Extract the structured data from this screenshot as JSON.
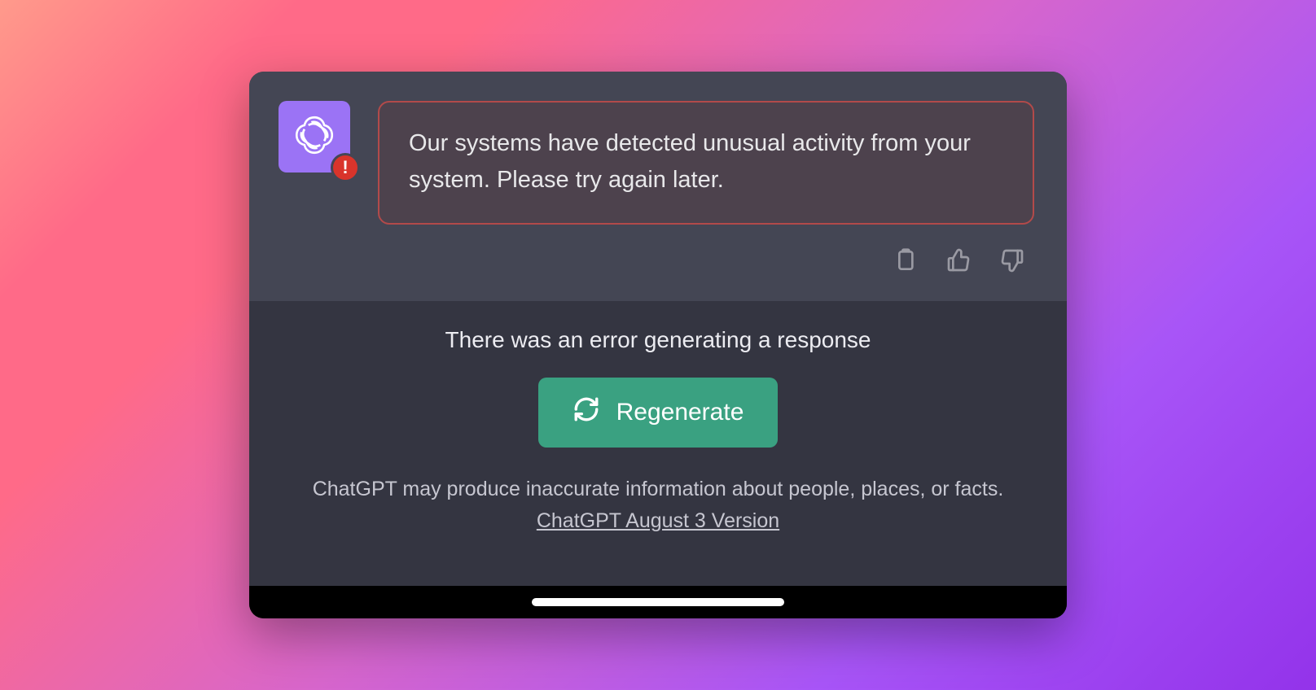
{
  "message": {
    "error_text": "Our systems have detected unusual activity from your system. Please try again later.",
    "avatar_icon": "openai-logo",
    "error_badge_icon": "exclamation"
  },
  "feedback_icons": [
    "copy",
    "thumbs-up",
    "thumbs-down"
  ],
  "footer": {
    "status_text": "There was an error generating a response",
    "regenerate_label": "Regenerate",
    "disclaimer_text": "ChatGPT may produce inaccurate information about people, places, or facts.",
    "version_link_text": "ChatGPT August 3 Version"
  },
  "colors": {
    "panel_bg": "#444654",
    "window_bg": "#343541",
    "avatar_bg": "#9b73f5",
    "error_border": "#b24a4a",
    "accent_green": "#3aa181",
    "error_badge": "#d9342b"
  }
}
